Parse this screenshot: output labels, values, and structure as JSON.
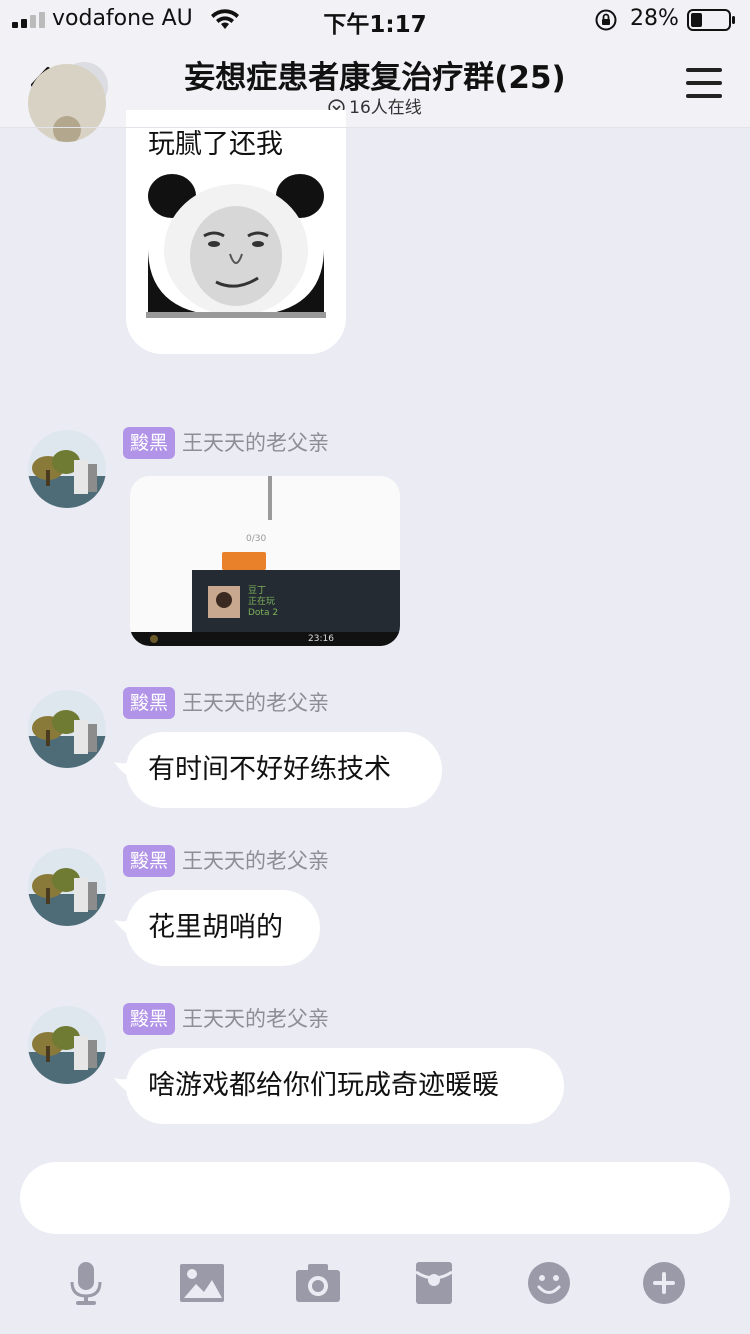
{
  "status_bar": {
    "carrier": "vodafone AU",
    "time": "下午1:17",
    "battery": "28%"
  },
  "header": {
    "back_count": "1",
    "title": "妄想症患者康复治疗群(25)",
    "online": "16人在线"
  },
  "messages": [
    {
      "type": "sticker",
      "text": "玩腻了还我",
      "image": "panda-meme-sticker"
    },
    {
      "type": "image",
      "tag": "黢黑",
      "sender": "王天天的老父亲",
      "screenshot": {
        "counter": "0/30",
        "friend_name": "豆丁",
        "status": "正在玩",
        "game": "Dota 2",
        "clock": "23:16"
      }
    },
    {
      "type": "text",
      "tag": "黢黑",
      "sender": "王天天的老父亲",
      "text": "有时间不好好练技术"
    },
    {
      "type": "text",
      "tag": "黢黑",
      "sender": "王天天的老父亲",
      "text": "花里胡哨的"
    },
    {
      "type": "text",
      "tag": "黢黑",
      "sender": "王天天的老父亲",
      "text": "啥游戏都给你们玩成奇迹暖暖"
    }
  ],
  "input": {
    "placeholder": ""
  },
  "toolbar": [
    "microphone-icon",
    "image-icon",
    "camera-icon",
    "red-packet-icon",
    "emoji-icon",
    "plus-icon"
  ],
  "colors": {
    "background": "#ebebf3",
    "tag": "#b194e8",
    "icon": "#9a9aa8"
  }
}
